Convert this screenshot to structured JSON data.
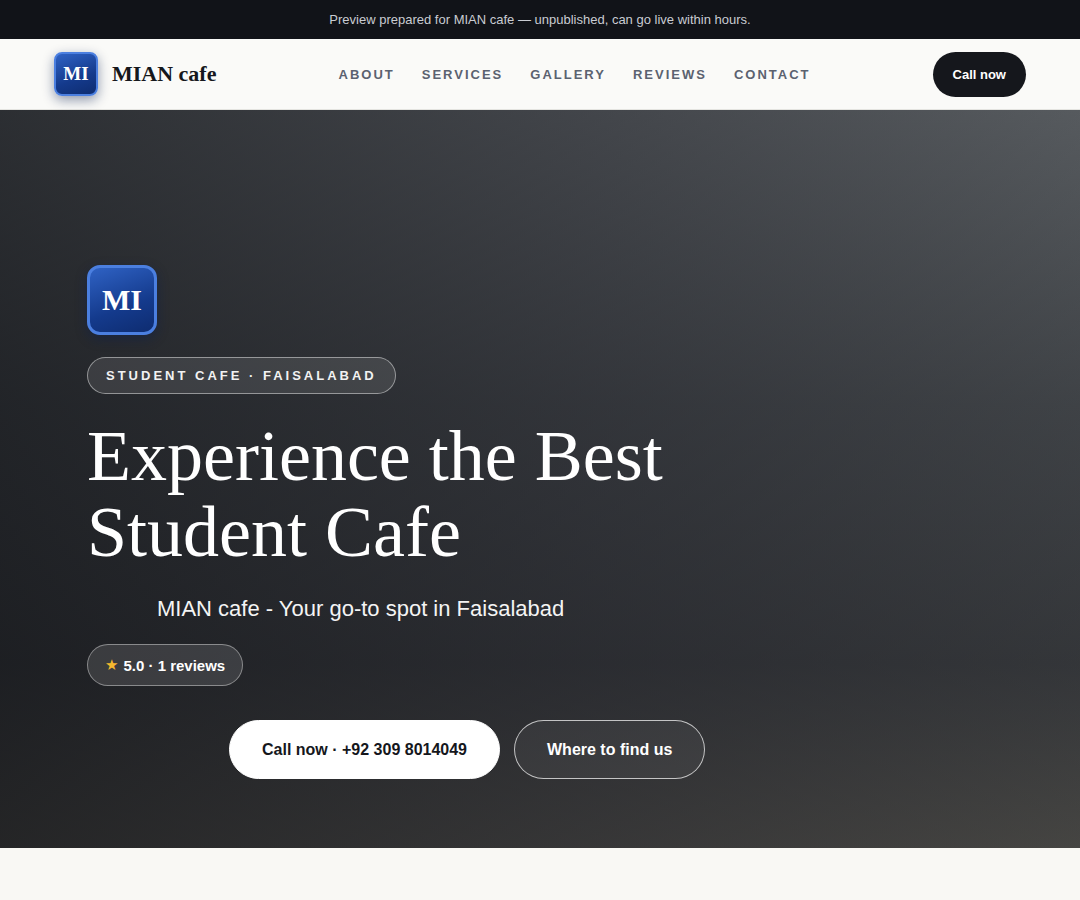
{
  "banner": {
    "text": "Preview prepared for MIAN cafe — unpublished, can go live within hours."
  },
  "header": {
    "brand": {
      "initials": "MI",
      "name": "MIAN cafe"
    },
    "nav": [
      {
        "label": "ABOUT"
      },
      {
        "label": "SERVICES"
      },
      {
        "label": "GALLERY"
      },
      {
        "label": "REVIEWS"
      },
      {
        "label": "CONTACT"
      }
    ],
    "cta": "Call now"
  },
  "hero": {
    "initials": "MI",
    "badge": "STUDENT CAFE · FAISALABAD",
    "title_lines": [
      "Experience the Best",
      "Student Cafe"
    ],
    "subtitle": "MIAN cafe - Your go-to spot in Faisalabad",
    "rating": {
      "star": "★",
      "text": "5.0 · 1 reviews"
    },
    "buttons": [
      {
        "label": "Call now · +92 309 8014049",
        "kind": "primary"
      },
      {
        "label": "Where to find us",
        "kind": "outline"
      }
    ]
  }
}
